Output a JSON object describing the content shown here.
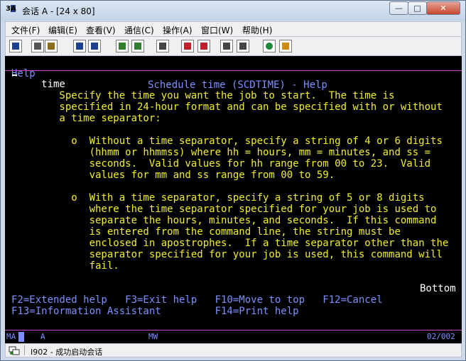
{
  "window": {
    "title": "会话 A - [24 x 80]",
    "app_icon_text": "A"
  },
  "menu": [
    {
      "label": "文件(F)"
    },
    {
      "label": "编辑(E)"
    },
    {
      "label": "查看(V)"
    },
    {
      "label": "通信(C)"
    },
    {
      "label": "操作(A)"
    },
    {
      "label": "窗口(W)"
    },
    {
      "label": "帮助(H)"
    }
  ],
  "toolbar": [
    {
      "icon": "print-screen-icon",
      "color": "#1f3f8f"
    },
    {
      "icon": "copy-icon",
      "color": "#555555"
    },
    {
      "icon": "paste-icon",
      "color": "#8a6d1f"
    },
    {
      "icon": "send-file-icon",
      "color": "#1f3f8f"
    },
    {
      "icon": "receive-file-icon",
      "color": "#1f3f8f"
    },
    {
      "icon": "display-keyboard-icon",
      "color": "#2f7f2f"
    },
    {
      "icon": "color-map-icon",
      "color": "#2f7f2f"
    },
    {
      "icon": "macro-record-icon",
      "color": "#444444"
    },
    {
      "icon": "macro-play-icon",
      "color": "#c0202a"
    },
    {
      "icon": "macro-stop-icon",
      "color": "#c0202a"
    },
    {
      "icon": "session-connect-icon",
      "color": "#444444"
    },
    {
      "icon": "session-disconnect-icon",
      "color": "#444444"
    },
    {
      "icon": "web-help-icon",
      "color": "#1a8a3a"
    },
    {
      "icon": "customize-icon",
      "color": "#d08a10"
    }
  ],
  "terminal": {
    "header_left": "Help",
    "header_title": "Schedule time (SCDTIME) - Help",
    "help_lines": [
      {
        "text": "     time",
        "color": "white"
      },
      {
        "text": "        Specify the time you want the job to start.  The time is",
        "color": "yellow"
      },
      {
        "text": "        specified in 24-hour format and can be specified with or without",
        "color": "yellow"
      },
      {
        "text": "        a time separator:",
        "color": "yellow"
      },
      {
        "text": "",
        "color": "yellow"
      },
      {
        "text": "          o  Without a time separator, specify a string of 4 or 6 digits",
        "color": "yellow"
      },
      {
        "text": "             (hhmm or hhmmss) where hh = hours, mm = minutes, and ss =",
        "color": "yellow"
      },
      {
        "text": "             seconds.  Valid values for hh range from 00 to 23.  Valid",
        "color": "yellow"
      },
      {
        "text": "             values for mm and ss range from 00 to 59.",
        "color": "yellow"
      },
      {
        "text": "",
        "color": "yellow"
      },
      {
        "text": "          o  With a time separator, specify a string of 5 or 8 digits",
        "color": "yellow"
      },
      {
        "text": "             where the time separator specified for your job is used to",
        "color": "yellow"
      },
      {
        "text": "             separate the hours, minutes, and seconds.  If this command",
        "color": "yellow"
      },
      {
        "text": "             is entered from the command line, the string must be",
        "color": "yellow"
      },
      {
        "text": "             enclosed in apostrophes.  If a time separator other than the",
        "color": "yellow"
      },
      {
        "text": "             separator specified for your job is used, this command will",
        "color": "yellow"
      },
      {
        "text": "             fail.",
        "color": "yellow"
      }
    ],
    "bottom_indicator": "Bottom",
    "fkeys_line1": "F2=Extended help   F3=Exit help   F10=Move to top   F12=Cancel",
    "fkeys_line2": "F13=Information Assistant         F14=Print help"
  },
  "oia": {
    "ma": "MA",
    "session": "A",
    "mode": "MW",
    "position": "02/002"
  },
  "status": {
    "text": "I902 - 成功启动会话"
  }
}
